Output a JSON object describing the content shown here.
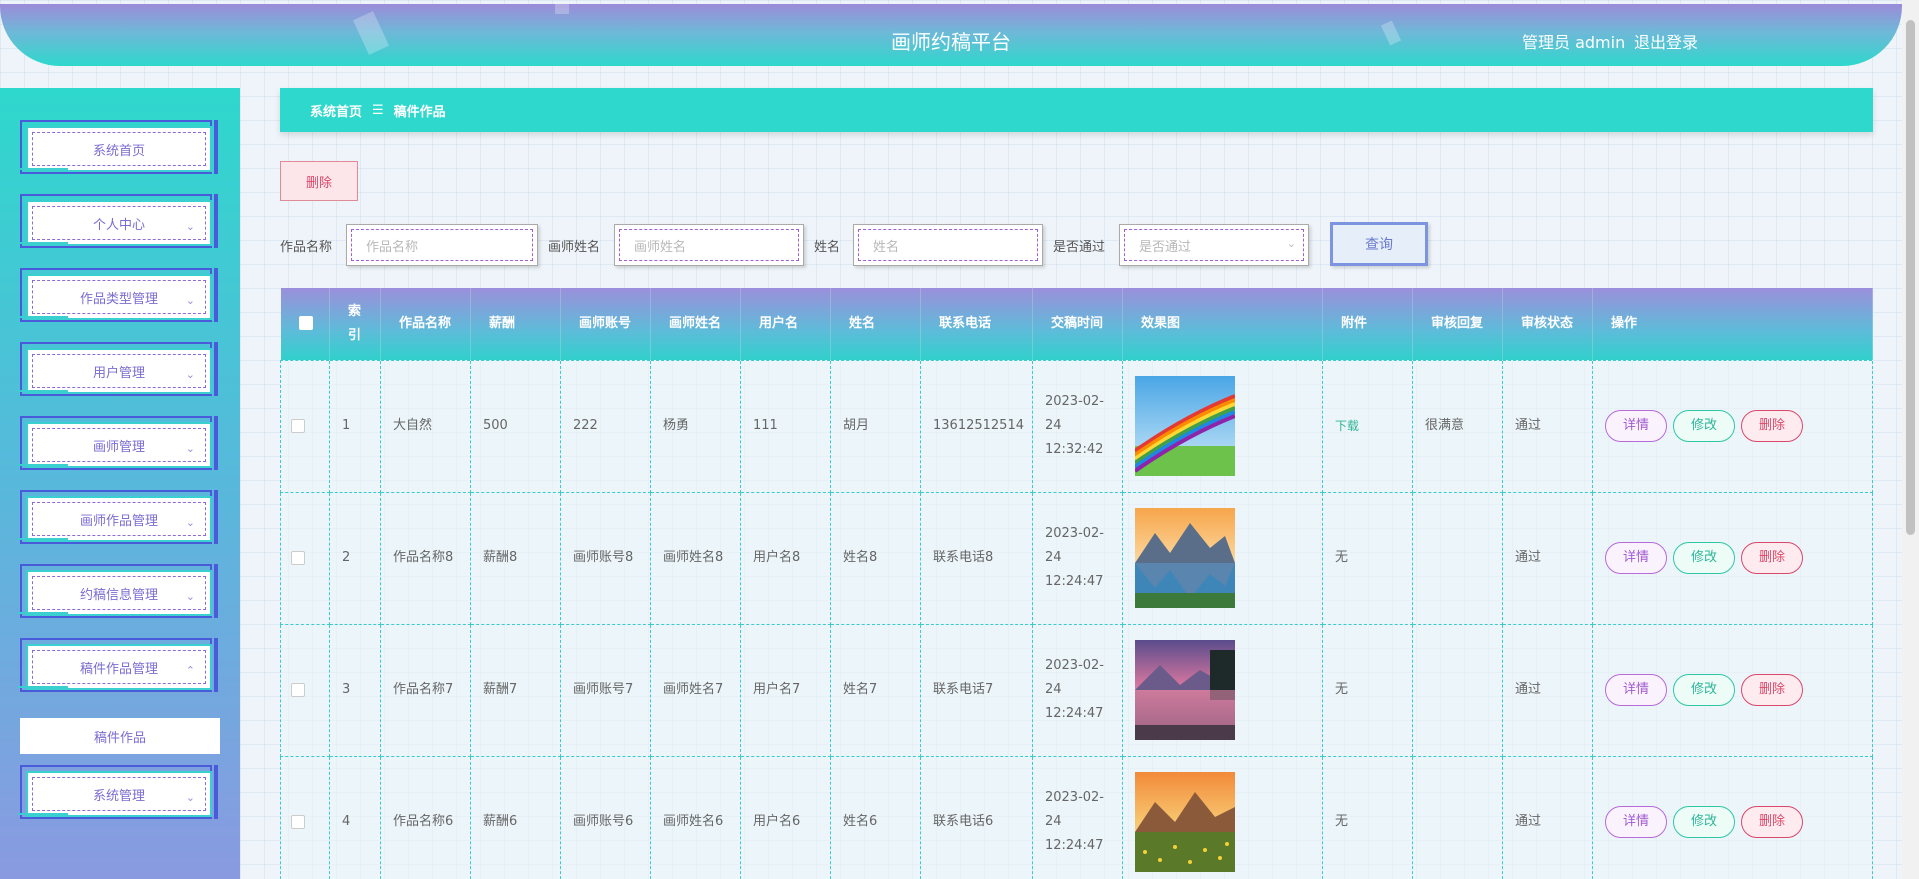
{
  "header": {
    "title": "画师约稿平台",
    "user_label": "管理员 admin",
    "logout_label": "退出登录"
  },
  "sidebar": {
    "items": [
      {
        "label": "系统首页",
        "has_arrow": false
      },
      {
        "label": "个人中心",
        "has_arrow": true,
        "arrow": "down"
      },
      {
        "label": "作品类型管理",
        "has_arrow": true,
        "arrow": "down"
      },
      {
        "label": "用户管理",
        "has_arrow": true,
        "arrow": "down"
      },
      {
        "label": "画师管理",
        "has_arrow": true,
        "arrow": "down"
      },
      {
        "label": "画师作品管理",
        "has_arrow": true,
        "arrow": "down"
      },
      {
        "label": "约稿信息管理",
        "has_arrow": true,
        "arrow": "down"
      },
      {
        "label": "稿件作品管理",
        "has_arrow": true,
        "arrow": "up"
      },
      {
        "label": "系统管理",
        "has_arrow": true,
        "arrow": "down"
      }
    ],
    "sub_item": "稿件作品"
  },
  "breadcrumb": {
    "home": "系统首页",
    "sep": "☰",
    "current": "稿件作品"
  },
  "toolbar": {
    "delete_label": "删除"
  },
  "search": {
    "fields": [
      {
        "label": "作品名称",
        "placeholder": "作品名称"
      },
      {
        "label": "画师姓名",
        "placeholder": "画师姓名"
      },
      {
        "label": "姓名",
        "placeholder": "姓名"
      },
      {
        "label": "是否通过",
        "placeholder": "是否通过",
        "is_select": true
      }
    ],
    "query_label": "查询"
  },
  "table": {
    "headers": [
      "索引",
      "作品名称",
      "薪酬",
      "画师账号",
      "画师姓名",
      "用户名",
      "姓名",
      "联系电话",
      "交稿时间",
      "效果图",
      "附件",
      "审核回复",
      "审核状态",
      "操作"
    ],
    "rows": [
      {
        "index": "1",
        "name": "大自然",
        "pay": "500",
        "account": "222",
        "artist": "杨勇",
        "username": "111",
        "realname": "胡月",
        "phone": "13612512514",
        "time": "2023-02-24 12:32:42",
        "image": "rainbow",
        "attachment": "下载",
        "reply": "很满意",
        "status": "通过"
      },
      {
        "index": "2",
        "name": "作品名称8",
        "pay": "薪酬8",
        "account": "画师账号8",
        "artist": "画师姓名8",
        "username": "用户名8",
        "realname": "姓名8",
        "phone": "联系电话8",
        "time": "2023-02-24 12:24:47",
        "image": "lake",
        "attachment": "无",
        "reply": "",
        "status": "通过"
      },
      {
        "index": "3",
        "name": "作品名称7",
        "pay": "薪酬7",
        "account": "画师账号7",
        "artist": "画师姓名7",
        "username": "用户名7",
        "realname": "姓名7",
        "phone": "联系电话7",
        "time": "2023-02-24 12:24:47",
        "image": "dusk",
        "attachment": "无",
        "reply": "",
        "status": "通过"
      },
      {
        "index": "4",
        "name": "作品名称6",
        "pay": "薪酬6",
        "account": "画师账号6",
        "artist": "画师姓名6",
        "username": "用户名6",
        "realname": "姓名6",
        "phone": "联系电话6",
        "time": "2023-02-24 12:24:47",
        "image": "meadow",
        "attachment": "无",
        "reply": "",
        "status": "通过"
      }
    ],
    "actions": {
      "detail": "详情",
      "edit": "修改",
      "delete": "删除"
    }
  }
}
